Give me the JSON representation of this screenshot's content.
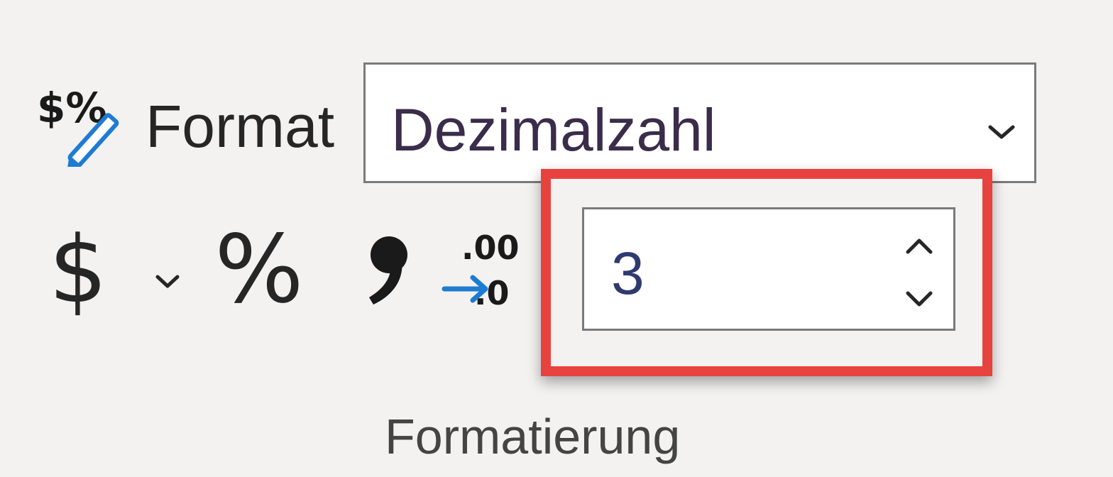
{
  "ribbon_group": {
    "title": "Formatierung",
    "number_format": {
      "label": "Format",
      "selected_value": "Dezimalzahl",
      "icon": "number-format-pencil-icon"
    },
    "buttons": [
      {
        "name": "currency",
        "glyph": "$",
        "icon": "dollar-icon"
      },
      {
        "name": "percent",
        "glyph": "%",
        "icon": "percent-icon"
      },
      {
        "name": "thousands-separator",
        "icon": "comma-icon"
      },
      {
        "name": "increase-decimal",
        "glyph_top": ".00",
        "glyph_bottom": ".0",
        "icon": "increase-decimal-icon"
      }
    ],
    "decimal_places": {
      "value": "3"
    }
  },
  "colors": {
    "highlight": "#e8423f",
    "accent_blue": "#1e7bd4",
    "background": "#f3f2f1"
  }
}
